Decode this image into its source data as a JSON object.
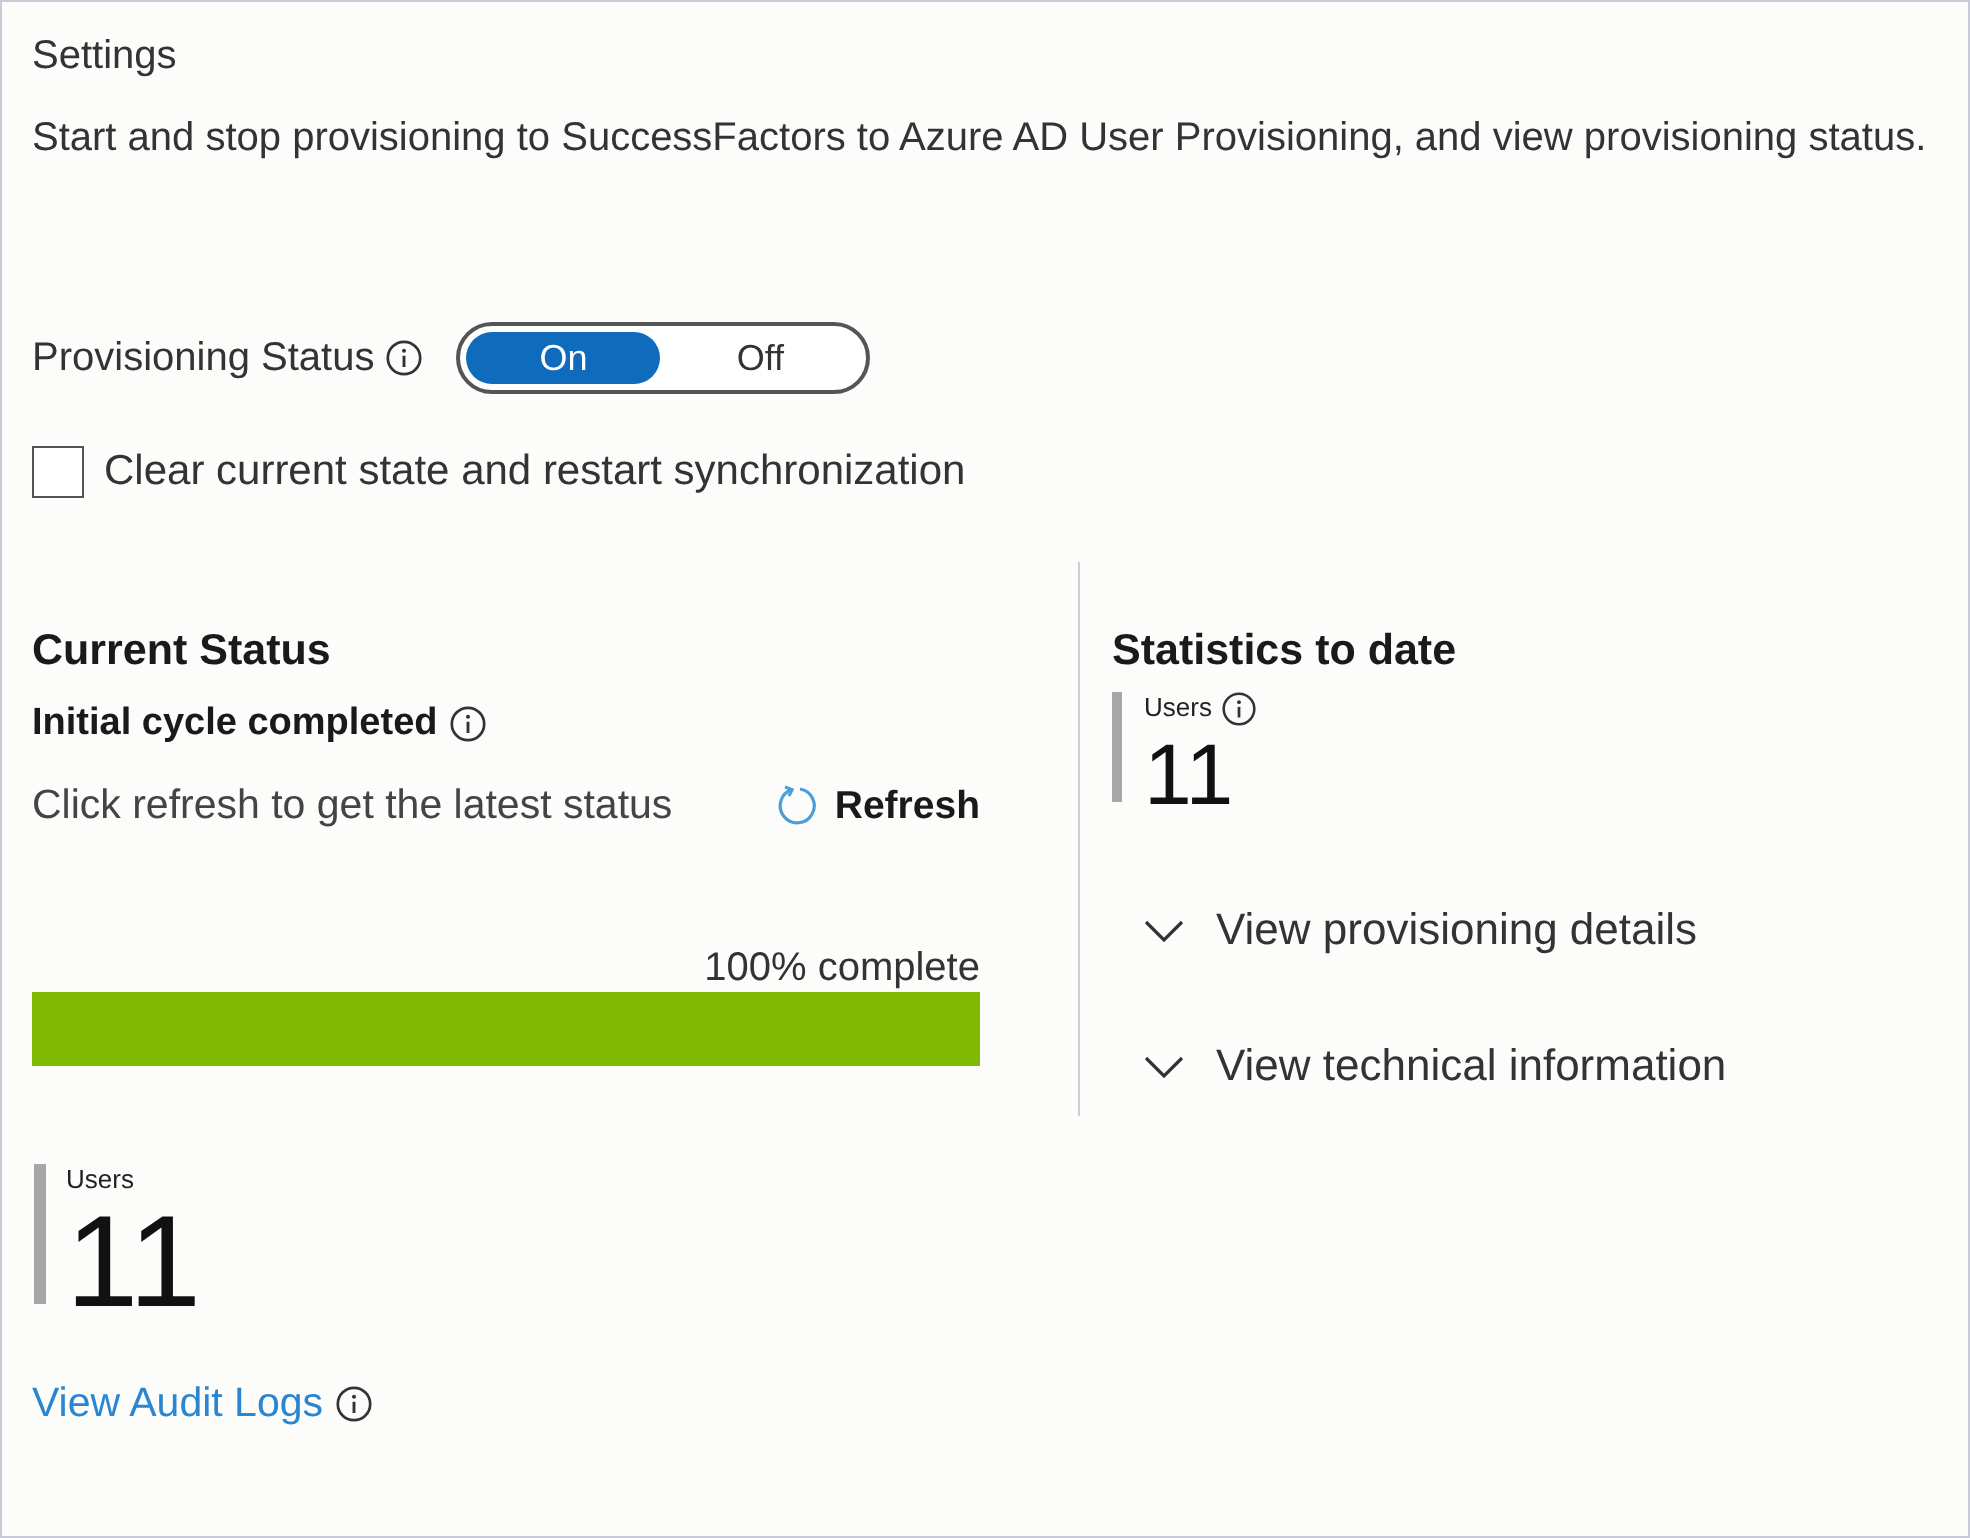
{
  "header": {
    "title": "Settings",
    "description": "Start and stop provisioning to SuccessFactors to Azure AD User Provisioning, and view provisioning status."
  },
  "provisioning_status": {
    "label": "Provisioning Status",
    "options": [
      {
        "label": "On",
        "selected": true
      },
      {
        "label": "Off",
        "selected": false
      }
    ]
  },
  "clear_state": {
    "label": "Clear current state and restart synchronization",
    "checked": false
  },
  "current_status": {
    "title": "Current Status",
    "state": "Initial cycle completed",
    "hint": "Click refresh to get the latest status",
    "refresh_label": "Refresh",
    "progress": {
      "reading": "100% complete",
      "level": 1
    },
    "stat": {
      "label": "Users",
      "value": "11"
    }
  },
  "statistics": {
    "title": "Statistics to date",
    "stat": {
      "label": "Users",
      "value": "11"
    },
    "sections": [
      {
        "label": "View provisioning details",
        "expanded": false
      },
      {
        "label": "View technical information",
        "expanded": false
      }
    ]
  },
  "audit_logs_link": "View Audit Logs"
}
